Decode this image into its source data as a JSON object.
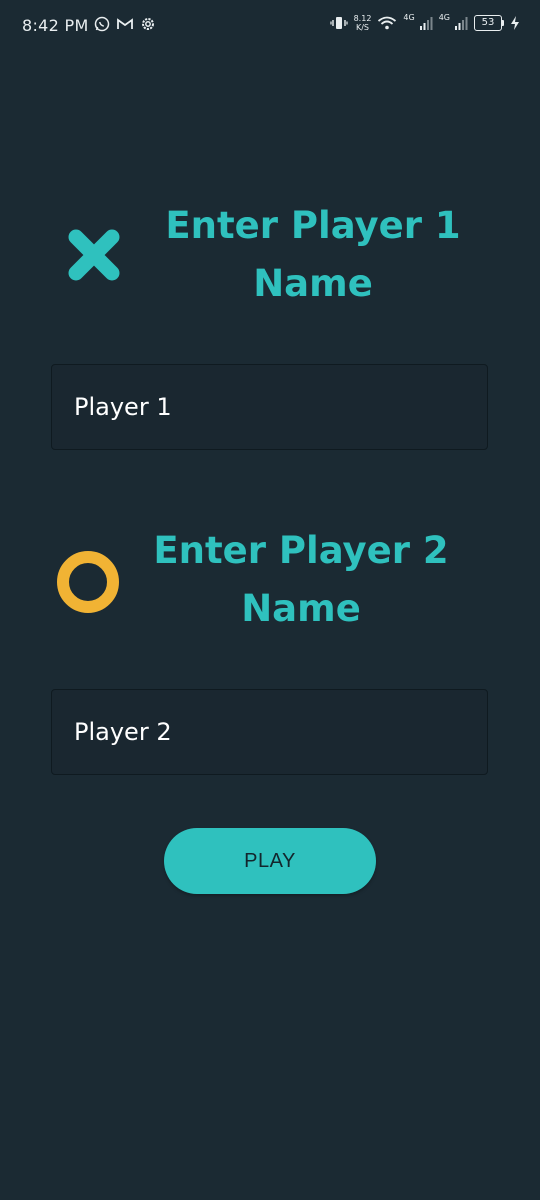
{
  "status_bar": {
    "time": "8:42 PM",
    "net_speed_value": "8.12",
    "net_speed_unit": "K/S",
    "network_1": "4G",
    "network_2": "4G",
    "battery_level": "53"
  },
  "player1": {
    "heading_line1": "Enter Player 1",
    "heading_line2": "Name",
    "input_value": "Player 1",
    "symbol_icon": "x-mark-icon",
    "symbol_color": "#2fc1be"
  },
  "player2": {
    "heading_line1": "Enter Player 2",
    "heading_line2": "Name",
    "input_value": "Player 2",
    "symbol_icon": "o-ring-icon",
    "symbol_color": "#f1b334"
  },
  "play_button_label": "PLAY",
  "colors": {
    "background": "#1b2a33",
    "accent": "#2fc1be",
    "o_color": "#f1b334"
  }
}
